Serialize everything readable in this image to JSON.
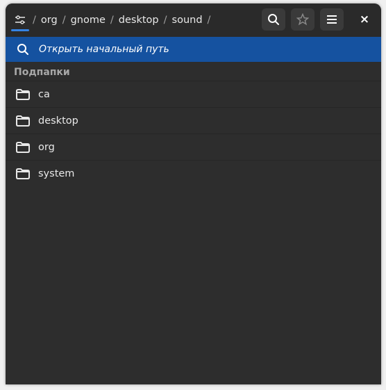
{
  "header": {
    "breadcrumb": [
      "org",
      "gnome",
      "desktop",
      "sound"
    ],
    "separator": "/",
    "buttons": [
      {
        "name": "search",
        "icon": "search-icon"
      },
      {
        "name": "bookmarks",
        "icon": "star-icon"
      },
      {
        "name": "menu",
        "icon": "hamburger-menu-icon"
      }
    ],
    "close_label": "×"
  },
  "search": {
    "text": "Открыть начальный путь",
    "icon": "search-icon"
  },
  "section_title": "Подпапки",
  "folders": [
    "ca",
    "desktop",
    "org",
    "system"
  ],
  "colors": {
    "accent": "#1552a0",
    "indicator": "#3584e4",
    "background": "#2d2d2d"
  }
}
